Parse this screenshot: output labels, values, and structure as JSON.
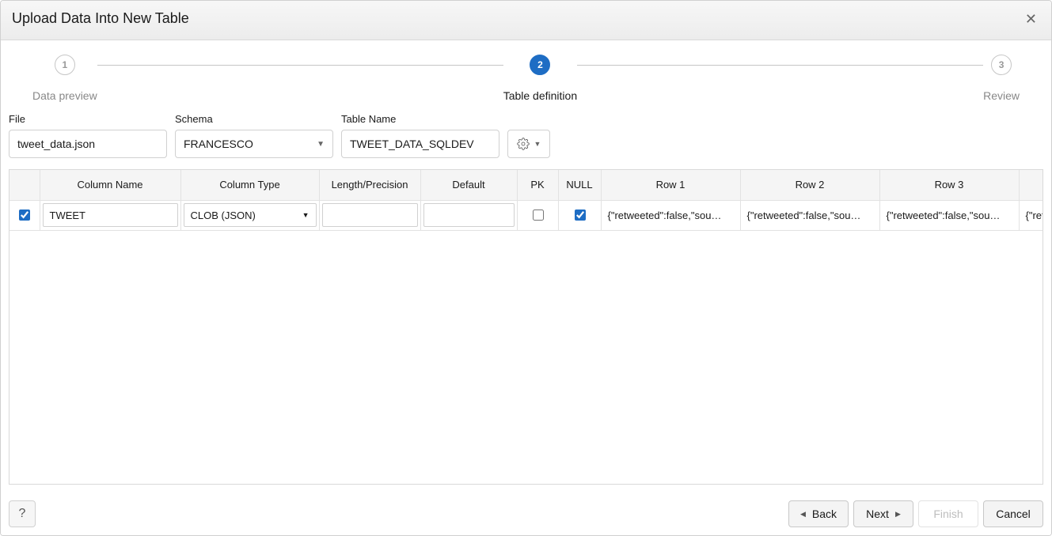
{
  "dialog": {
    "title": "Upload Data Into New Table"
  },
  "stepper": {
    "steps": [
      {
        "num": "1",
        "label": "Data preview"
      },
      {
        "num": "2",
        "label": "Table definition"
      },
      {
        "num": "3",
        "label": "Review"
      }
    ]
  },
  "form": {
    "file_label": "File",
    "file_value": "tweet_data.json",
    "schema_label": "Schema",
    "schema_value": "FRANCESCO",
    "table_label": "Table Name",
    "table_value": "TWEET_DATA_SQLDEV"
  },
  "table": {
    "headers": {
      "name": "Column Name",
      "type": "Column Type",
      "len": "Length/Precision",
      "def": "Default",
      "pk": "PK",
      "null": "NULL",
      "r1": "Row 1",
      "r2": "Row 2",
      "r3": "Row 3"
    },
    "rows": [
      {
        "checked": true,
        "name": "TWEET",
        "type": "CLOB (JSON)",
        "len": "",
        "def": "",
        "pk": false,
        "null": true,
        "r1": "{\"retweeted\":false,\"sou…",
        "r2": "{\"retweeted\":false,\"sou…",
        "r3": "{\"retweeted\":false,\"sou…",
        "r4": "{\"ret"
      }
    ]
  },
  "footer": {
    "back": "Back",
    "next": "Next",
    "finish": "Finish",
    "cancel": "Cancel"
  }
}
